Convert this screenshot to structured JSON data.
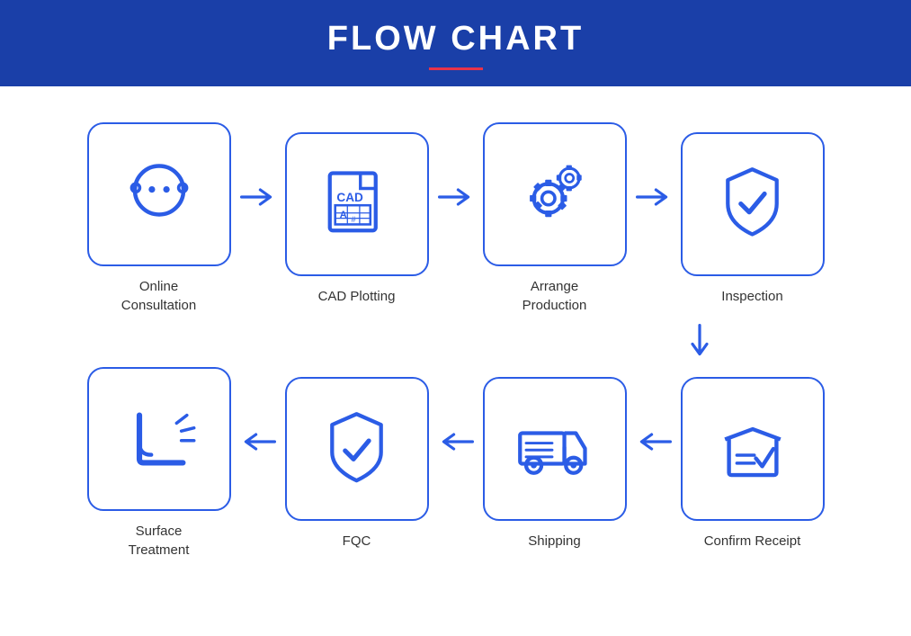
{
  "header": {
    "title": "FLOW CHART"
  },
  "steps": [
    {
      "id": "online-consultation",
      "label": "Online\nConsultation",
      "icon": "person"
    },
    {
      "id": "cad-plotting",
      "label": "CAD Plotting",
      "icon": "cad"
    },
    {
      "id": "arrange-production",
      "label": "Arrange\nProduction",
      "icon": "gears"
    },
    {
      "id": "inspection",
      "label": "Inspection",
      "icon": "shield-check"
    },
    {
      "id": "surface-treatment",
      "label": "Surface\nTreatment",
      "icon": "surface"
    },
    {
      "id": "fqc",
      "label": "FQC",
      "icon": "shield-check2"
    },
    {
      "id": "shipping",
      "label": "Shipping",
      "icon": "truck"
    },
    {
      "id": "confirm-receipt",
      "label": "Confirm Receipt",
      "icon": "box-check"
    }
  ]
}
